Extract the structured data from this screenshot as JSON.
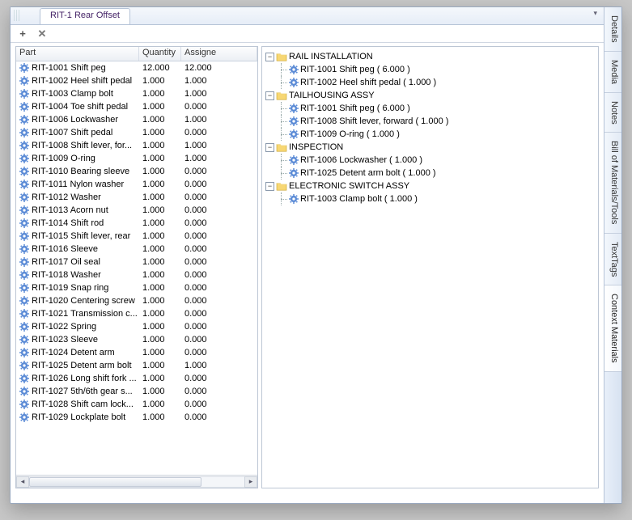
{
  "tab_title": "RIT-1 Rear Offset",
  "columns": {
    "part": "Part",
    "qty": "Quantity",
    "assigned": "Assigne"
  },
  "parts": [
    {
      "name": "RIT-1001 Shift peg",
      "qty": "12.000",
      "assigned": "12.000"
    },
    {
      "name": "RIT-1002 Heel shift pedal",
      "qty": "1.000",
      "assigned": "1.000"
    },
    {
      "name": "RIT-1003 Clamp bolt",
      "qty": "1.000",
      "assigned": "1.000"
    },
    {
      "name": "RIT-1004 Toe shift pedal",
      "qty": "1.000",
      "assigned": "0.000"
    },
    {
      "name": "RIT-1006 Lockwasher",
      "qty": "1.000",
      "assigned": "1.000"
    },
    {
      "name": "RIT-1007 Shift pedal",
      "qty": "1.000",
      "assigned": "0.000"
    },
    {
      "name": "RIT-1008 Shift lever, for...",
      "qty": "1.000",
      "assigned": "1.000"
    },
    {
      "name": "RIT-1009 O-ring",
      "qty": "1.000",
      "assigned": "1.000"
    },
    {
      "name": "RIT-1010 Bearing sleeve",
      "qty": "1.000",
      "assigned": "0.000"
    },
    {
      "name": "RIT-1011 Nylon washer",
      "qty": "1.000",
      "assigned": "0.000"
    },
    {
      "name": "RIT-1012 Washer",
      "qty": "1.000",
      "assigned": "0.000"
    },
    {
      "name": "RIT-1013 Acorn nut",
      "qty": "1.000",
      "assigned": "0.000"
    },
    {
      "name": "RIT-1014 Shift rod",
      "qty": "1.000",
      "assigned": "0.000"
    },
    {
      "name": "RIT-1015 Shift lever, rear",
      "qty": "1.000",
      "assigned": "0.000"
    },
    {
      "name": "RIT-1016 Sleeve",
      "qty": "1.000",
      "assigned": "0.000"
    },
    {
      "name": "RIT-1017 Oil seal",
      "qty": "1.000",
      "assigned": "0.000"
    },
    {
      "name": "RIT-1018 Washer",
      "qty": "1.000",
      "assigned": "0.000"
    },
    {
      "name": "RIT-1019 Snap ring",
      "qty": "1.000",
      "assigned": "0.000"
    },
    {
      "name": "RIT-1020 Centering screw",
      "qty": "1.000",
      "assigned": "0.000"
    },
    {
      "name": "RIT-1021 Transmission c...",
      "qty": "1.000",
      "assigned": "0.000"
    },
    {
      "name": "RIT-1022 Spring",
      "qty": "1.000",
      "assigned": "0.000"
    },
    {
      "name": "RIT-1023 Sleeve",
      "qty": "1.000",
      "assigned": "0.000"
    },
    {
      "name": "RIT-1024 Detent arm",
      "qty": "1.000",
      "assigned": "0.000"
    },
    {
      "name": "RIT-1025 Detent arm bolt",
      "qty": "1.000",
      "assigned": "1.000"
    },
    {
      "name": "RIT-1026 Long shift fork ...",
      "qty": "1.000",
      "assigned": "0.000"
    },
    {
      "name": "RIT-1027 5th/6th gear s...",
      "qty": "1.000",
      "assigned": "0.000"
    },
    {
      "name": "RIT-1028 Shift cam lock...",
      "qty": "1.000",
      "assigned": "0.000"
    },
    {
      "name": "RIT-1029 Lockplate bolt",
      "qty": "1.000",
      "assigned": "0.000"
    }
  ],
  "tree": [
    {
      "label": "RAIL INSTALLATION",
      "children": [
        {
          "label": "RIT-1001 Shift peg ( 6.000 )"
        },
        {
          "label": "RIT-1002 Heel shift pedal  ( 1.000 )"
        }
      ]
    },
    {
      "label": "TAILHOUSING ASSY",
      "children": [
        {
          "label": "RIT-1001 Shift peg ( 6.000 )"
        },
        {
          "label": "RIT-1008 Shift lever, forward ( 1.000 )"
        },
        {
          "label": "RIT-1009 O-ring  ( 1.000 )"
        }
      ]
    },
    {
      "label": "INSPECTION",
      "children": [
        {
          "label": "RIT-1006 Lockwasher ( 1.000 )"
        },
        {
          "label": "RIT-1025 Detent arm bolt ( 1.000 )"
        }
      ]
    },
    {
      "label": "ELECTRONIC SWITCH ASSY",
      "children": [
        {
          "label": "RIT-1003 Clamp bolt ( 1.000 )"
        }
      ]
    }
  ],
  "sidetabs": [
    {
      "label": "Details",
      "active": false
    },
    {
      "label": "Media",
      "active": false
    },
    {
      "label": "Notes",
      "active": false
    },
    {
      "label": "Bill of Materials/Tools",
      "active": false
    },
    {
      "label": "TextTags",
      "active": false
    },
    {
      "label": "Context Materials",
      "active": true
    }
  ]
}
